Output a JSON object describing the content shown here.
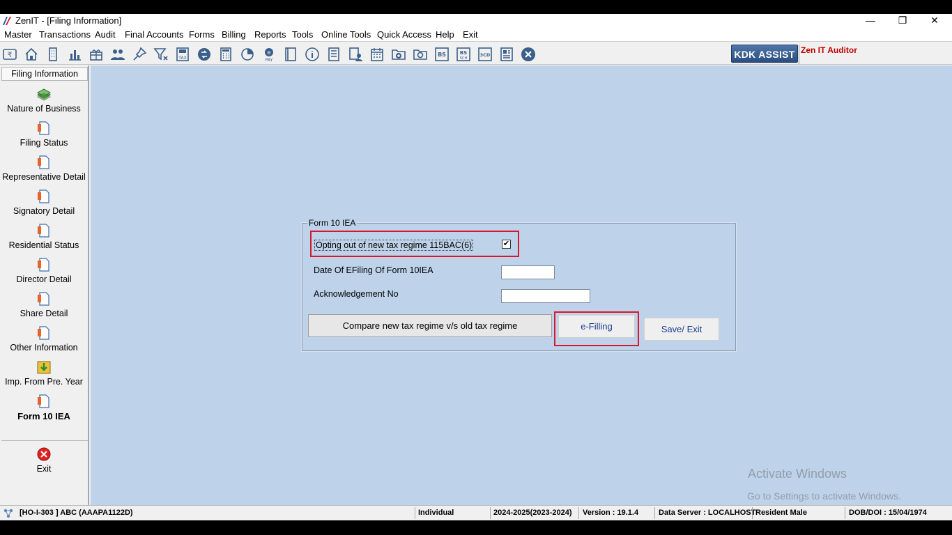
{
  "window": {
    "title": "ZenIT - [Filing Information]",
    "controls": {
      "minimize": "—",
      "restore": "❐",
      "close": "✕"
    }
  },
  "menu": [
    "Master",
    "Transactions",
    "Audit",
    "Final Accounts",
    "Forms",
    "Billing",
    "Reports",
    "Tools",
    "Online Tools",
    "Quick Access",
    "Help",
    "Exit"
  ],
  "toolbar": {
    "icons": [
      "rupee-note-icon",
      "home-icon",
      "building-icon",
      "bar-chart-icon",
      "gift-icon",
      "users-icon",
      "pin-icon",
      "filter-icon",
      "tax-save-icon",
      "refresh-arrow-icon",
      "calculator-icon",
      "pie-chart-icon",
      "epay-icon",
      "book-icon",
      "info-icon",
      "report-icon",
      "user-document-icon",
      "calendar-icon",
      "add-folder-icon",
      "folder-search-icon",
      "bs-icon",
      "bs-sch-icon",
      "3cd-icon",
      "form-icon",
      "close-circle-icon"
    ],
    "kdk_assist": "KDK ASSIST",
    "brand": "Zen IT Auditor",
    "brand_color": "#c00000"
  },
  "sidebar": {
    "header": "Filing Information",
    "items": [
      {
        "label": "Nature of Business",
        "icon": "money-stack-icon"
      },
      {
        "label": "Filing Status",
        "icon": "document-icon"
      },
      {
        "label": "Representative Detail",
        "icon": "document-icon"
      },
      {
        "label": "Signatory Detail",
        "icon": "document-icon"
      },
      {
        "label": "Residential Status",
        "icon": "document-icon"
      },
      {
        "label": "Director Detail",
        "icon": "document-icon"
      },
      {
        "label": "Share Detail",
        "icon": "document-icon"
      },
      {
        "label": "Other Information",
        "icon": "document-icon"
      },
      {
        "label": "Imp. From Pre. Year",
        "icon": "import-icon"
      },
      {
        "label": "Form 10 IEA",
        "icon": "document-icon"
      }
    ],
    "exit": "Exit"
  },
  "form": {
    "legend": "Form 10 IEA",
    "opt_out_label": "Opting out of new tax regime 115BAC(6)",
    "opt_out_checked": "✔",
    "date_label": "Date Of EFiling Of Form 10IEA",
    "date_value": "",
    "ack_label": "Acknowledgement No",
    "ack_value": "",
    "compare_button": "Compare new tax regime v/s old tax regime",
    "efilling_button": "e-Filling",
    "save_exit_button": "Save/ Exit"
  },
  "watermark": {
    "line1": "Activate Windows",
    "line2": "Go to Settings to activate Windows."
  },
  "status": {
    "client": "[HO-I-303 ] ABC (AAAPA1122D)",
    "type": "Individual",
    "year": "2024-2025(2023-2024)",
    "version": "Version : 19.1.4",
    "server": "Data Server : LOCALHOST",
    "residency": "Resident Male",
    "dob": "DOB/DOI : 15/04/1974"
  },
  "colors": {
    "main_bg": "#bed3ea",
    "highlight": "#d7172e",
    "link": "#1a3c8a"
  }
}
